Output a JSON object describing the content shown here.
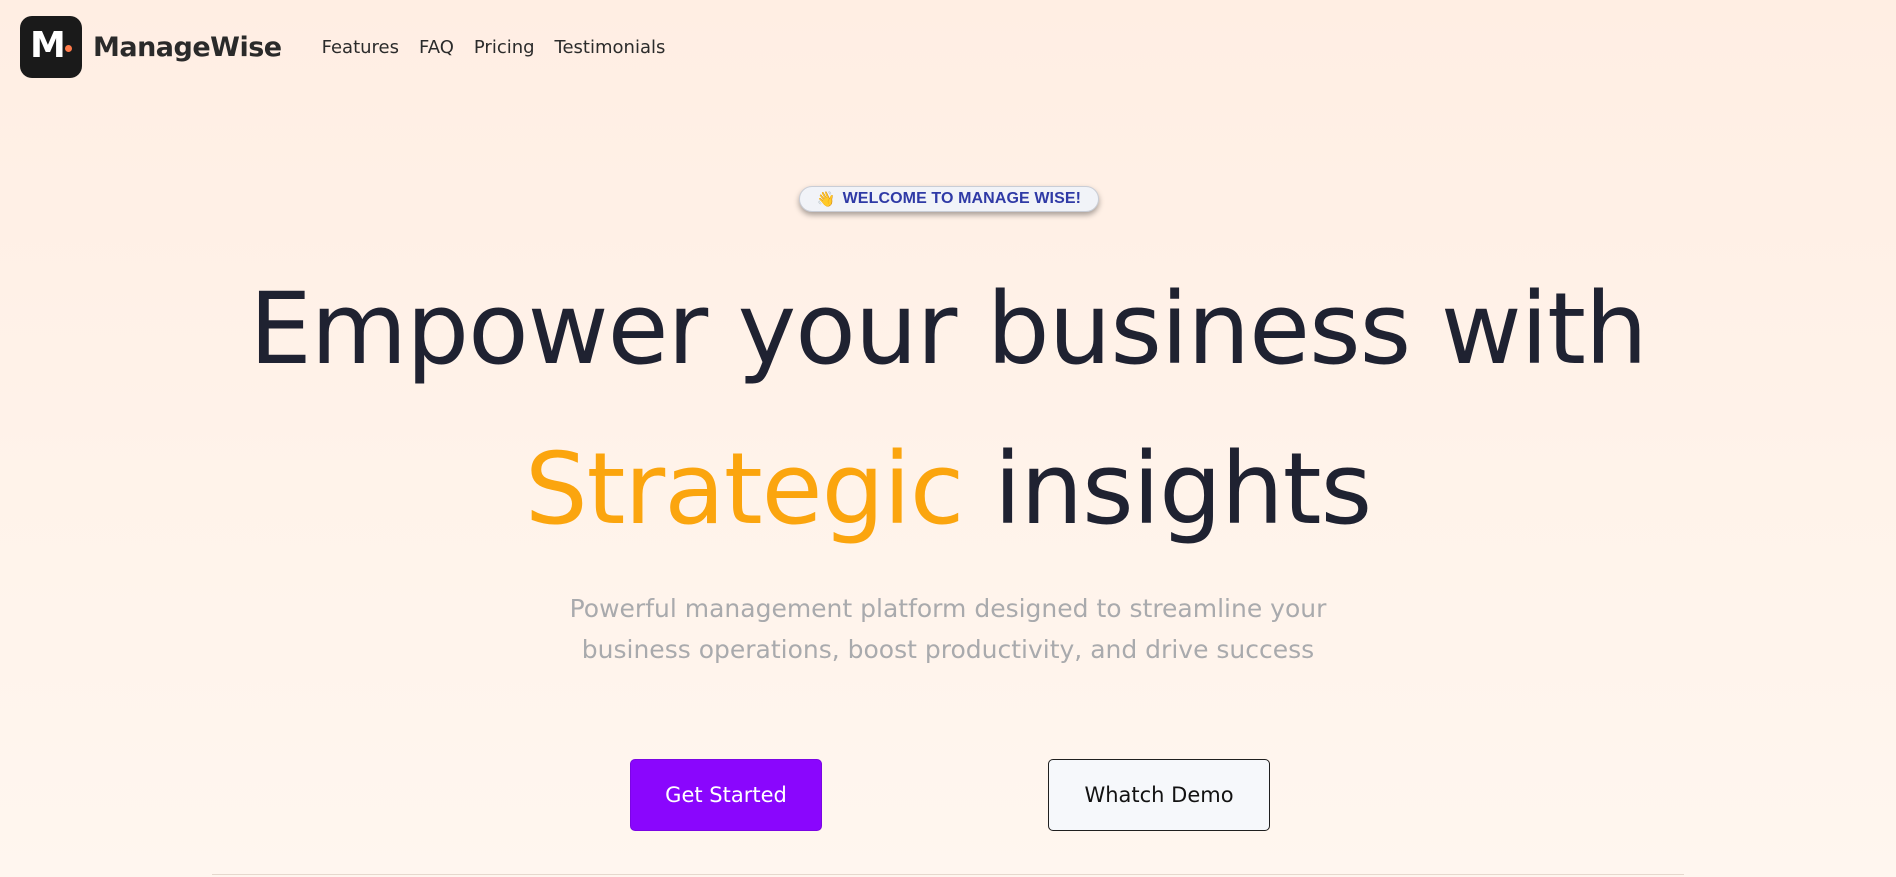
{
  "header": {
    "logo_letter": "M",
    "brand": "ManageWise",
    "nav": [
      {
        "label": "Features"
      },
      {
        "label": "FAQ"
      },
      {
        "label": "Pricing"
      },
      {
        "label": "Testimonials"
      }
    ]
  },
  "hero": {
    "badge_icon": "waving-hand-icon",
    "badge_emoji": "👋",
    "badge_text": "WELCOME TO MANAGE WISE!",
    "title_line1": "Empower your business with",
    "title_accent": "Strategic",
    "title_line2_rest": " insights",
    "subtitle_line1": "Powerful management platform designed to streamline your",
    "subtitle_line2": "business operations, boost productivity, and drive success",
    "primary_button": "Get Started",
    "secondary_button": "Whatch Demo"
  },
  "colors": {
    "accent": "#fba50e",
    "primary_button": "#8a06fd",
    "heading": "#1f2231",
    "subtitle": "#a9aaad",
    "badge_text": "#2f3aa6",
    "logo_dot": "#ff7a4a"
  }
}
